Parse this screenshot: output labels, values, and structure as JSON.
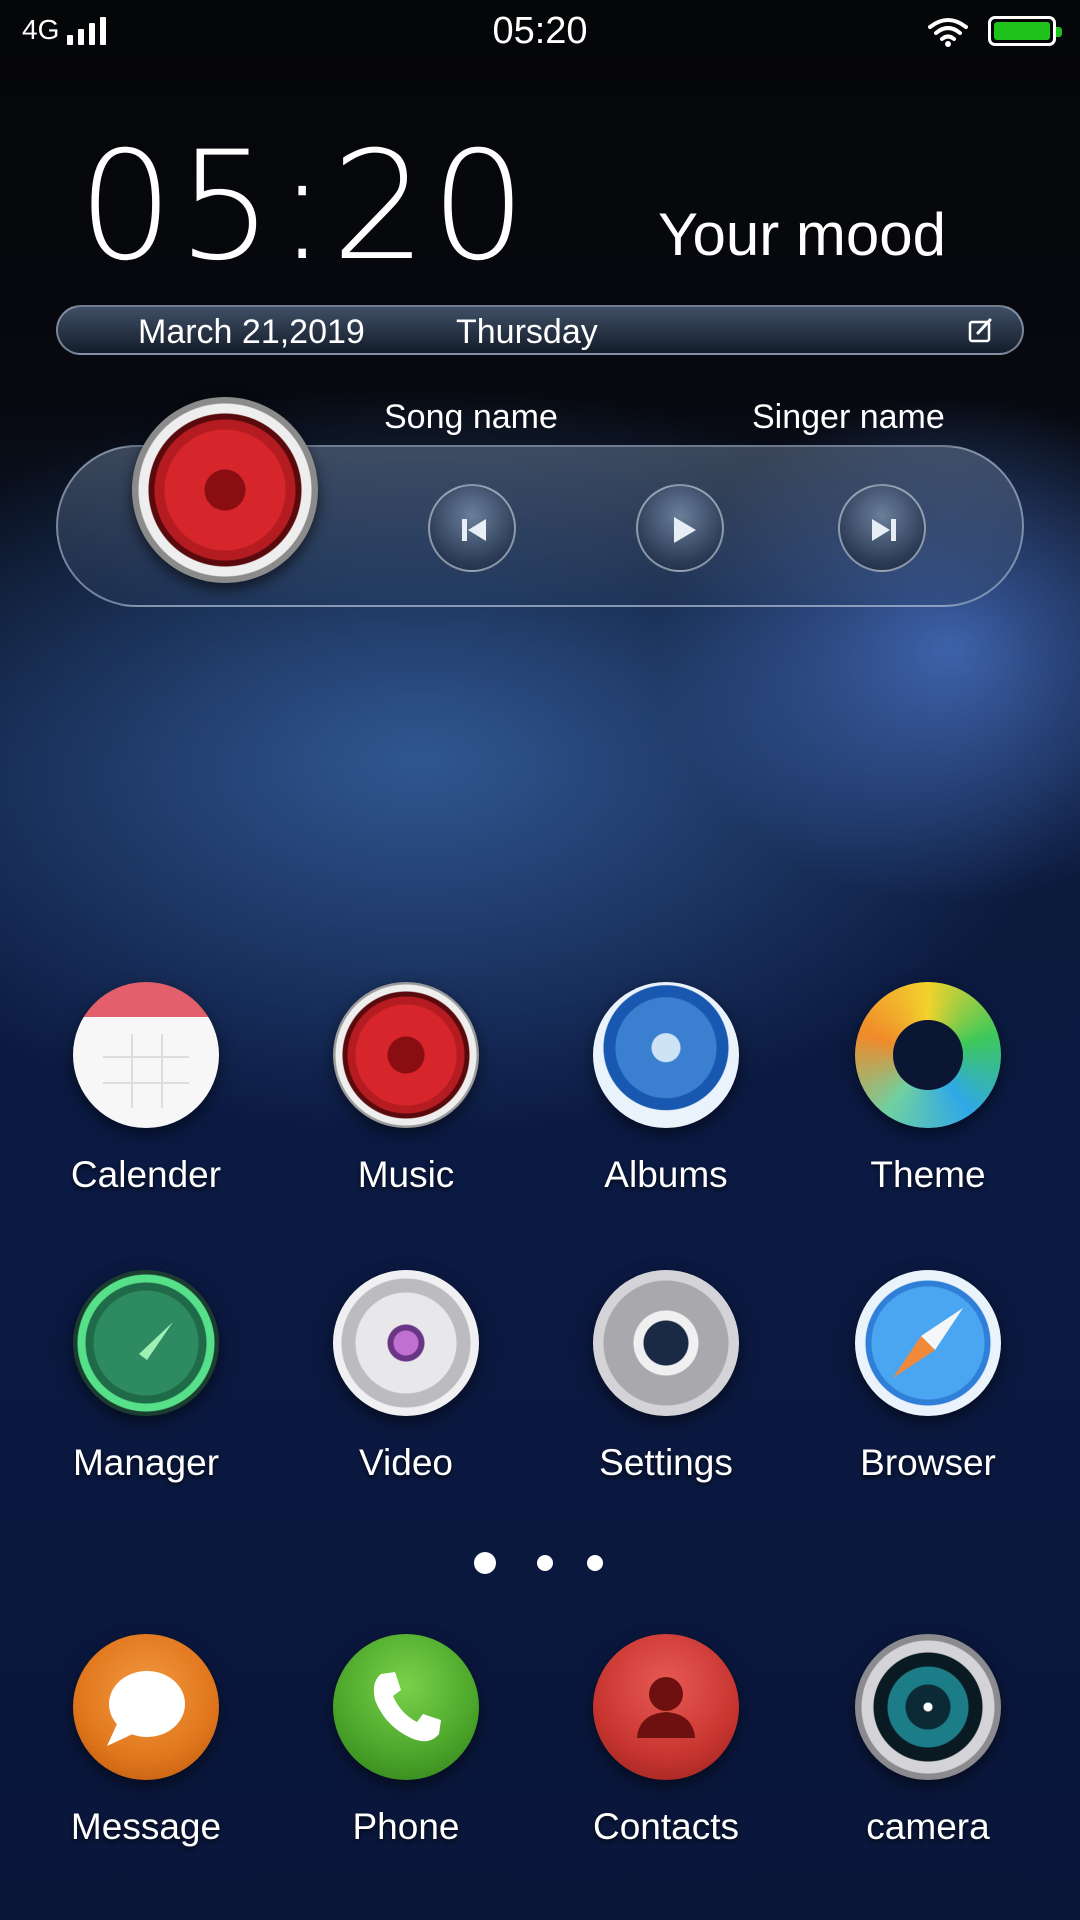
{
  "status_bar": {
    "network": "4G",
    "time": "05:20",
    "battery_color": "#1ec21a"
  },
  "widget": {
    "clock": "05:20",
    "mood": "Your mood",
    "date": "March 21,2019",
    "day": "Thursday",
    "song_label": "Song name",
    "singer_label": "Singer name"
  },
  "apps_row1": [
    {
      "label": "Calender",
      "icon": "calendar-icon"
    },
    {
      "label": "Music",
      "icon": "music-icon"
    },
    {
      "label": "Albums",
      "icon": "albums-icon"
    },
    {
      "label": "Theme",
      "icon": "theme-icon"
    }
  ],
  "apps_row2": [
    {
      "label": "Manager",
      "icon": "manager-icon"
    },
    {
      "label": "Video",
      "icon": "video-icon"
    },
    {
      "label": "Settings",
      "icon": "settings-icon"
    },
    {
      "label": "Browser",
      "icon": "browser-icon"
    }
  ],
  "page_indicator": {
    "pages": 3,
    "current": 1
  },
  "dock": [
    {
      "label": "Message",
      "icon": "message-icon"
    },
    {
      "label": "Phone",
      "icon": "phone-icon"
    },
    {
      "label": "Contacts",
      "icon": "contacts-icon"
    },
    {
      "label": "camera",
      "icon": "camera-icon"
    }
  ]
}
